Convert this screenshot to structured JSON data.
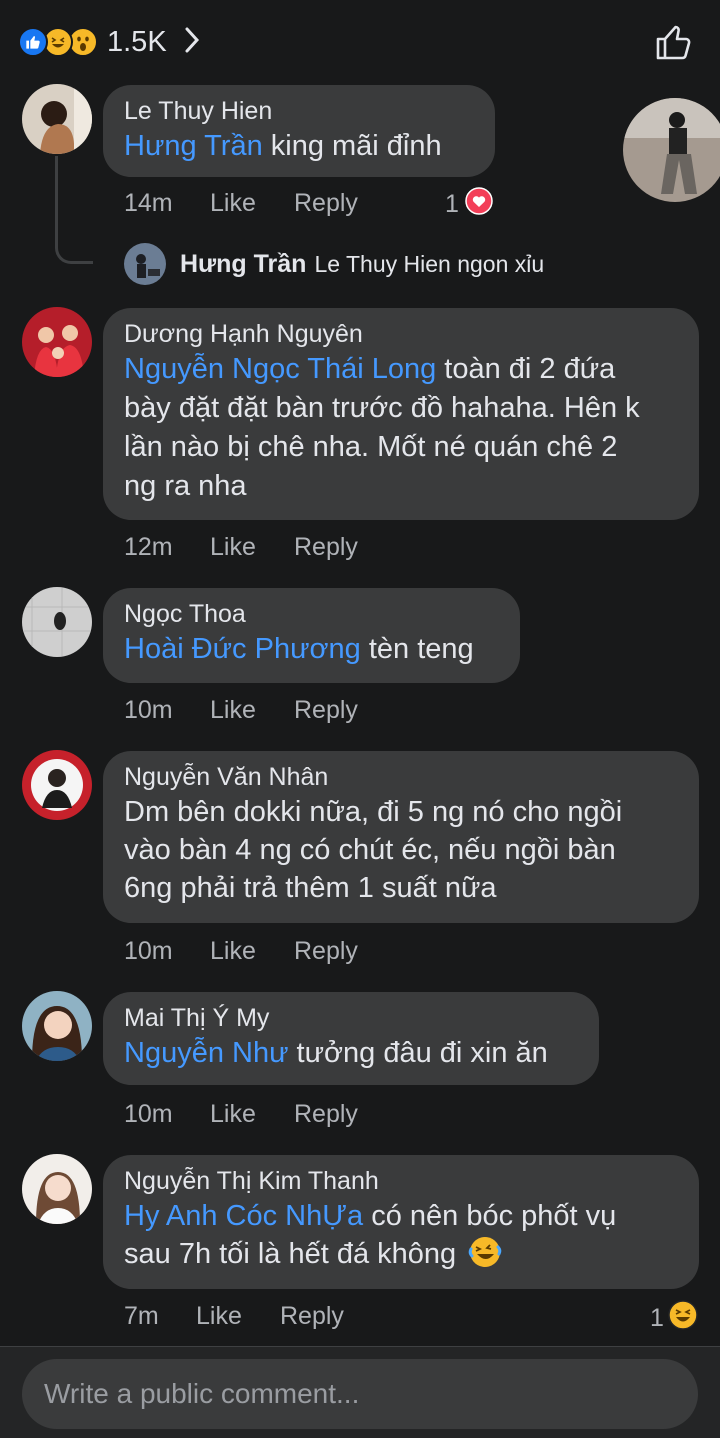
{
  "header": {
    "reaction_count": "1.5K"
  },
  "comments": [
    {
      "author": "Le Thuy Hien",
      "mention": "Hưng Trần",
      "text": " king mãi đỉnh",
      "time": "14m",
      "like": "Like",
      "reply": "Reply",
      "react_count": "1",
      "reply_preview": {
        "author": "Hưng Trần",
        "text": "Le Thuy Hien ngon xỉu"
      }
    },
    {
      "author": "Dương Hạnh Nguyên",
      "mention": "Nguyễn Ngọc Thái Long",
      "line1": " toàn đi 2 đứa",
      "line2": "bày đặt đặt bàn trước đồ hahaha. Hên k",
      "line3": "lần nào bị chê nha. Mốt né quán chê 2",
      "line4": "ng ra nha",
      "time": "12m",
      "like": "Like",
      "reply": "Reply"
    },
    {
      "author": "Ngọc Thoa",
      "mention": "Hoài Đức Phương",
      "text": " tèn teng",
      "time": "10m",
      "like": "Like",
      "reply": "Reply"
    },
    {
      "author": "Nguyễn Văn Nhân",
      "line1": "Dm bên dokki nữa, đi 5 ng nó cho ngồi",
      "line2": "vào bàn 4 ng có chút éc, nếu ngồi bàn",
      "line3": "6ng phải trả thêm 1 suất nữa",
      "time": "10m",
      "like": "Like",
      "reply": "Reply"
    },
    {
      "author": "Mai Thị Ý My",
      "mention": "Nguyễn Như",
      "text": " tưởng đâu đi xin ăn",
      "time": "10m",
      "like": "Like",
      "reply": "Reply"
    },
    {
      "author": "Nguyễn Thị Kim Thanh",
      "mention": "Hy Anh Cóc NhỰa",
      "line1": " có nên bóc phốt vụ",
      "line2": "sau 7h tối là hết đá không",
      "time": "7m",
      "like": "Like",
      "reply": "Reply",
      "react_count": "1"
    }
  ],
  "composer": {
    "placeholder": "Write a public comment..."
  },
  "colors": {
    "background": "#18191a",
    "bubble": "#3a3b3c",
    "mention": "#4599ff",
    "meta": "#b0b3b8",
    "like_blue": "#1877f2",
    "love_red": "#f33e58",
    "haha_yellow": "#f7b928"
  },
  "icons": [
    "like-reaction-icon",
    "haha-reaction-icon",
    "wow-reaction-icon",
    "chevron-right-icon",
    "thumbs-up-icon",
    "love-reaction-icon",
    "laughing-tears-emoji-icon"
  ]
}
